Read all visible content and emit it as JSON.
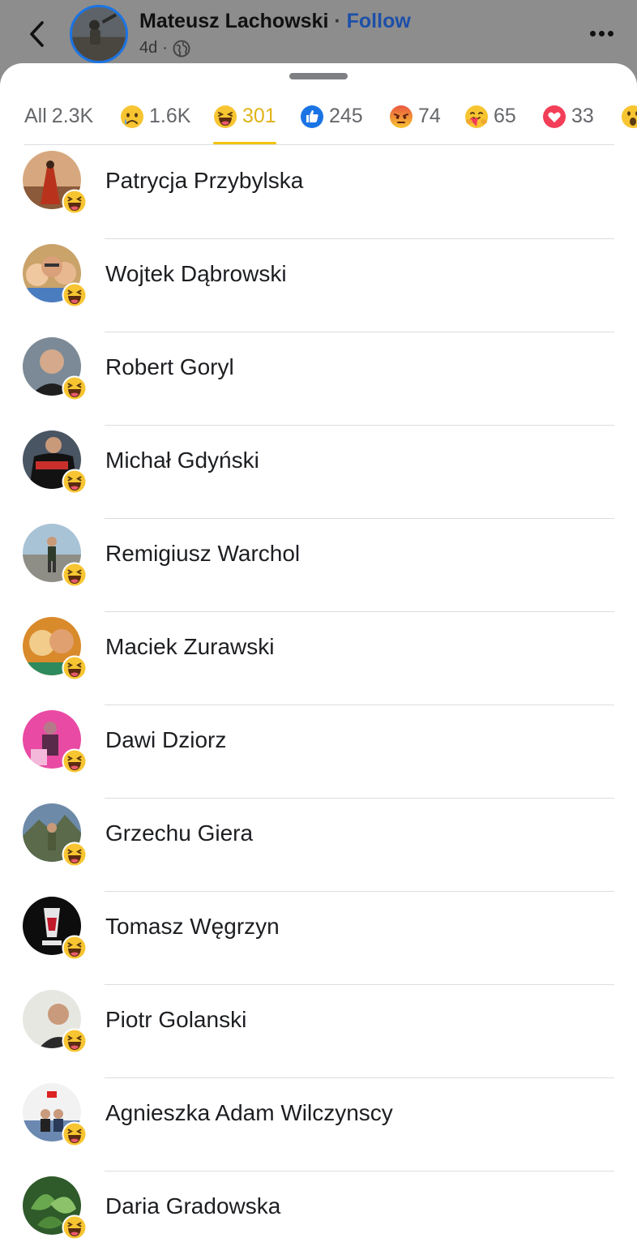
{
  "header": {
    "author": "Mateusz Lachowski",
    "separator": "·",
    "follow_label": "Follow",
    "time_ago": "4d",
    "meta_separator": "·",
    "privacy_icon": "globe-icon",
    "accent_color": "#1d4fa8"
  },
  "tabs": [
    {
      "label": "All",
      "count": "2.3K",
      "icon": null
    },
    {
      "count": "1.6K",
      "icon": "sad"
    },
    {
      "count": "301",
      "icon": "haha",
      "active": true
    },
    {
      "count": "245",
      "icon": "like"
    },
    {
      "count": "74",
      "icon": "angry"
    },
    {
      "count": "65",
      "icon": "care"
    },
    {
      "count": "33",
      "icon": "love"
    },
    {
      "count": "",
      "icon": "wow"
    }
  ],
  "people": [
    {
      "name": "Patrycja Przybylska",
      "reaction": "haha"
    },
    {
      "name": "Wojtek Dąbrowski",
      "reaction": "haha"
    },
    {
      "name": "Robert Goryl",
      "reaction": "haha"
    },
    {
      "name": "Michał Gdyński",
      "reaction": "haha"
    },
    {
      "name": "Remigiusz Warchol",
      "reaction": "haha"
    },
    {
      "name": "Maciek Zurawski",
      "reaction": "haha"
    },
    {
      "name": "Dawi Dziorz",
      "reaction": "haha"
    },
    {
      "name": "Grzechu Giera",
      "reaction": "haha"
    },
    {
      "name": "Tomasz Węgrzyn",
      "reaction": "haha"
    },
    {
      "name": "Piotr Golanski",
      "reaction": "haha"
    },
    {
      "name": "Agnieszka Adam Wilczynscy",
      "reaction": "haha"
    },
    {
      "name": "Daria Gradowska",
      "reaction": "haha"
    }
  ],
  "colors": {
    "active_tab": "#e0b31a",
    "active_underline": "#f1c40f",
    "like_blue": "#1b74e4",
    "love_red": "#f33e58"
  }
}
